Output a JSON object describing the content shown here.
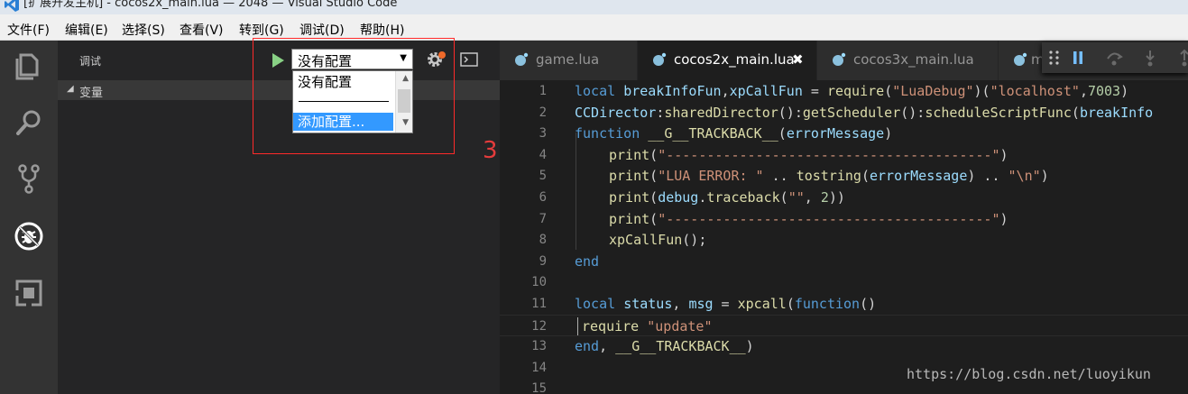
{
  "window": {
    "title": "[扩展开发主机] - cocos2x_main.lua — 2048 — Visual Studio Code"
  },
  "menu": [
    {
      "label": "文件(F)"
    },
    {
      "label": "编辑(E)"
    },
    {
      "label": "选择(S)"
    },
    {
      "label": "查看(V)"
    },
    {
      "label": "转到(G)"
    },
    {
      "label": "调试(D)"
    },
    {
      "label": "帮助(H)"
    }
  ],
  "activitybar": {
    "items": [
      "explorer-icon",
      "search-icon",
      "source-control-icon",
      "debug-icon",
      "extensions-icon"
    ]
  },
  "debug_panel": {
    "title": "调试",
    "config_selected": "没有配置",
    "dropdown_options": [
      "没有配置",
      "添加配置..."
    ],
    "variables_section": "变量"
  },
  "annotation": {
    "label": "3",
    "color": "#e53c3c"
  },
  "tabs": [
    {
      "label": "game.lua",
      "active": false
    },
    {
      "label": "cocos2x_main.lua",
      "active": true
    },
    {
      "label": "cocos3x_main.lua",
      "active": false
    },
    {
      "label": "m",
      "active": false
    }
  ],
  "debug_toolbar": {
    "buttons": [
      "drag-handle-icon",
      "pause-icon",
      "step-over-icon",
      "step-into-icon",
      "step-out-icon"
    ]
  },
  "editor": {
    "lines": [
      {
        "num": "1",
        "text": "local breakInfoFun,xpCallFun = require(\"LuaDebug\")(\"localhost\",7003)"
      },
      {
        "num": "2",
        "text": "CCDirector:sharedDirector():getScheduler():scheduleScriptFunc(breakInfo"
      },
      {
        "num": "3",
        "text": "function __G__TRACKBACK__(errorMessage)"
      },
      {
        "num": "4",
        "text": "print(\"----------------------------------------\")"
      },
      {
        "num": "5",
        "text": "print(\"LUA ERROR: \" .. tostring(errorMessage) .. \"\\n\")"
      },
      {
        "num": "6",
        "text": "print(debug.traceback(\"\", 2))"
      },
      {
        "num": "7",
        "text": "print(\"----------------------------------------\")"
      },
      {
        "num": "8",
        "text": "xpCallFun();"
      },
      {
        "num": "9",
        "text": "end"
      },
      {
        "num": "10",
        "text": ""
      },
      {
        "num": "11",
        "text": "local status, msg = xpcall(function()"
      },
      {
        "num": "12",
        "text": "require \"update\""
      },
      {
        "num": "13",
        "text": "end, __G__TRACKBACK__)"
      },
      {
        "num": "14",
        "text": ""
      },
      {
        "num": "15",
        "text": ""
      }
    ]
  },
  "watermark": "https://blog.csdn.net/luoyikun",
  "colors": {
    "accent": "#3399ff",
    "highlight_box": "#ff2a2a",
    "run_green": "#89d185",
    "keyword": "#569cd6",
    "string": "#ce9178"
  }
}
